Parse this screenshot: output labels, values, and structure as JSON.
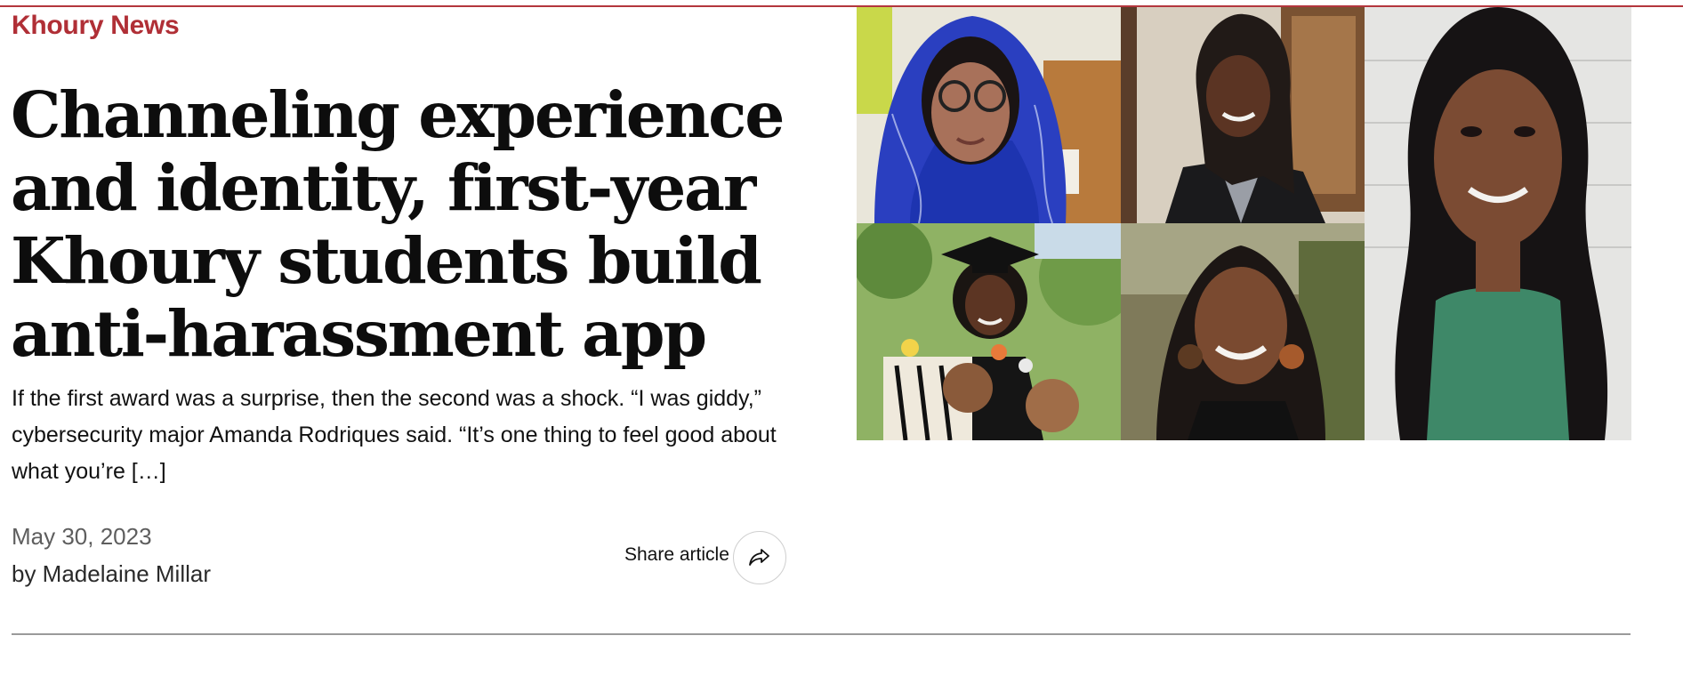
{
  "site": {
    "section_label": "Khoury News",
    "accent_color": "#b02f36"
  },
  "article": {
    "headline": "Channeling experience and identity, first-year Khoury students build anti-harassment app",
    "excerpt": "If the first award was a surprise, then the second was a shock. “I was giddy,” cybersecurity major Amanda Rodriques said. “It’s one thing to feel good about what you’re […]",
    "date": "May 30, 2023",
    "byline": "by Madelaine Millar",
    "share_label": "Share article",
    "share_icon": "share-arrow-icon"
  },
  "image": {
    "kind": "photo-collage",
    "photos": [
      "portrait-blue-headscarf",
      "portrait-braids-blazer",
      "portrait-long-hair",
      "portrait-graduation",
      "portrait-outdoor-smile"
    ]
  }
}
